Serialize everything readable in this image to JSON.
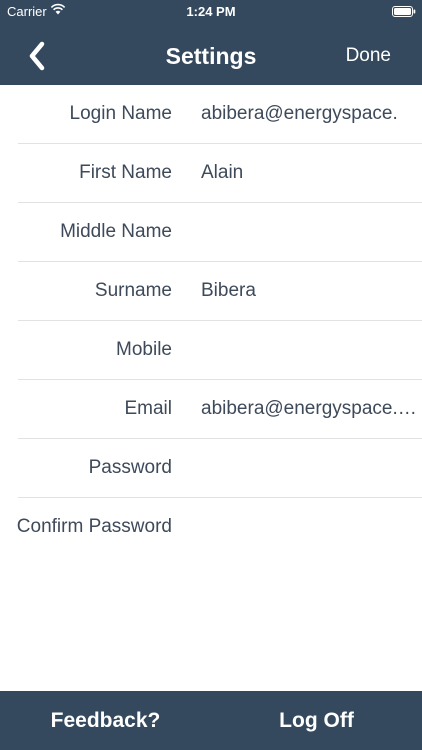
{
  "status_bar": {
    "carrier": "Carrier",
    "time": "1:24 PM"
  },
  "nav": {
    "title": "Settings",
    "done_label": "Done"
  },
  "form": {
    "rows": [
      {
        "label": "Login Name",
        "value": "abibera@energyspace."
      },
      {
        "label": "First Name",
        "value": "Alain"
      },
      {
        "label": "Middle Name",
        "value": ""
      },
      {
        "label": "Surname",
        "value": "Bibera"
      },
      {
        "label": "Mobile",
        "value": ""
      },
      {
        "label": "Email",
        "value": "abibera@energyspace.c…"
      },
      {
        "label": "Password",
        "value": ""
      },
      {
        "label": "Confirm Password",
        "value": ""
      }
    ]
  },
  "bottom": {
    "feedback_label": "Feedback?",
    "logoff_label": "Log Off"
  },
  "colors": {
    "bar_background": "#34495e",
    "text_primary": "#3e4a5a",
    "separator": "#e2e2e2"
  },
  "icons": {
    "back": "chevron-left-icon",
    "wifi": "wifi-icon",
    "battery": "battery-icon"
  }
}
